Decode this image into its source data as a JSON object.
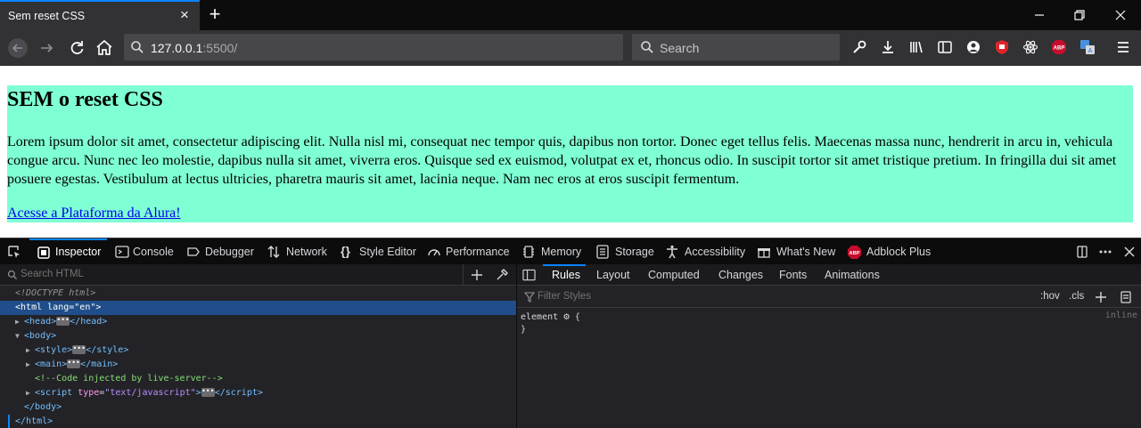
{
  "browser": {
    "tab_title": "Sem reset CSS",
    "url_host": "127.0.0.1",
    "url_rest": ":5500/",
    "search_placeholder": "Search",
    "toolbar_icons": [
      "wrench-icon",
      "download-icon",
      "library-icon",
      "sidebar-icon",
      "account-icon",
      "ublock-icon",
      "react-icon",
      "adblock-plus-icon",
      "translate-icon",
      "menu-icon"
    ]
  },
  "page": {
    "heading": "SEM o reset CSS",
    "paragraph": "Lorem ipsum dolor sit amet, consectetur adipiscing elit. Nulla nisl mi, consequat nec tempor quis, dapibus non tortor. Donec eget tellus felis. Maecenas massa nunc, hendrerit in arcu in, vehicula congue arcu. Nunc nec leo molestie, dapibus nulla sit amet, viverra eros. Quisque sed ex euismod, volutpat ex et, rhoncus odio. In suscipit tortor sit amet tristique pretium. In fringilla dui sit amet posuere egestas. Vestibulum at lectus ultricies, pharetra mauris sit amet, lacinia neque. Nam nec eros at eros suscipit fermentum.",
    "link": "Acesse a Plataforma da Alura!",
    "main_bg": "#7fffd4"
  },
  "devtools": {
    "tabs": [
      "Inspector",
      "Console",
      "Debugger",
      "Network",
      "Style Editor",
      "Performance",
      "Memory",
      "Storage",
      "Accessibility",
      "What's New",
      "Adblock Plus"
    ],
    "selected_tab": "Inspector",
    "search_html_placeholder": "Search HTML",
    "tree": {
      "doctype": "<!DOCTYPE html>",
      "html_open": "html",
      "html_attr": "lang",
      "html_attr_val": "\"en\"",
      "head": "head",
      "body": "body",
      "style": "style",
      "main": "main",
      "comment": "<!--Code injected by live-server-->",
      "script": "script",
      "script_attr": "type",
      "script_attr_val": "\"text/javascript\"",
      "body_close": "</body>",
      "html_close": "</html>"
    },
    "side_tabs": [
      "Rules",
      "Layout",
      "Computed",
      "Changes",
      "Fonts",
      "Animations"
    ],
    "selected_side_tab": "Rules",
    "filter_placeholder": "Filter Styles",
    "hov_label": ":hov",
    "cls_label": ".cls",
    "rule_selector": "element",
    "rule_open": "{",
    "rule_close": "}",
    "rule_source": "inline"
  }
}
